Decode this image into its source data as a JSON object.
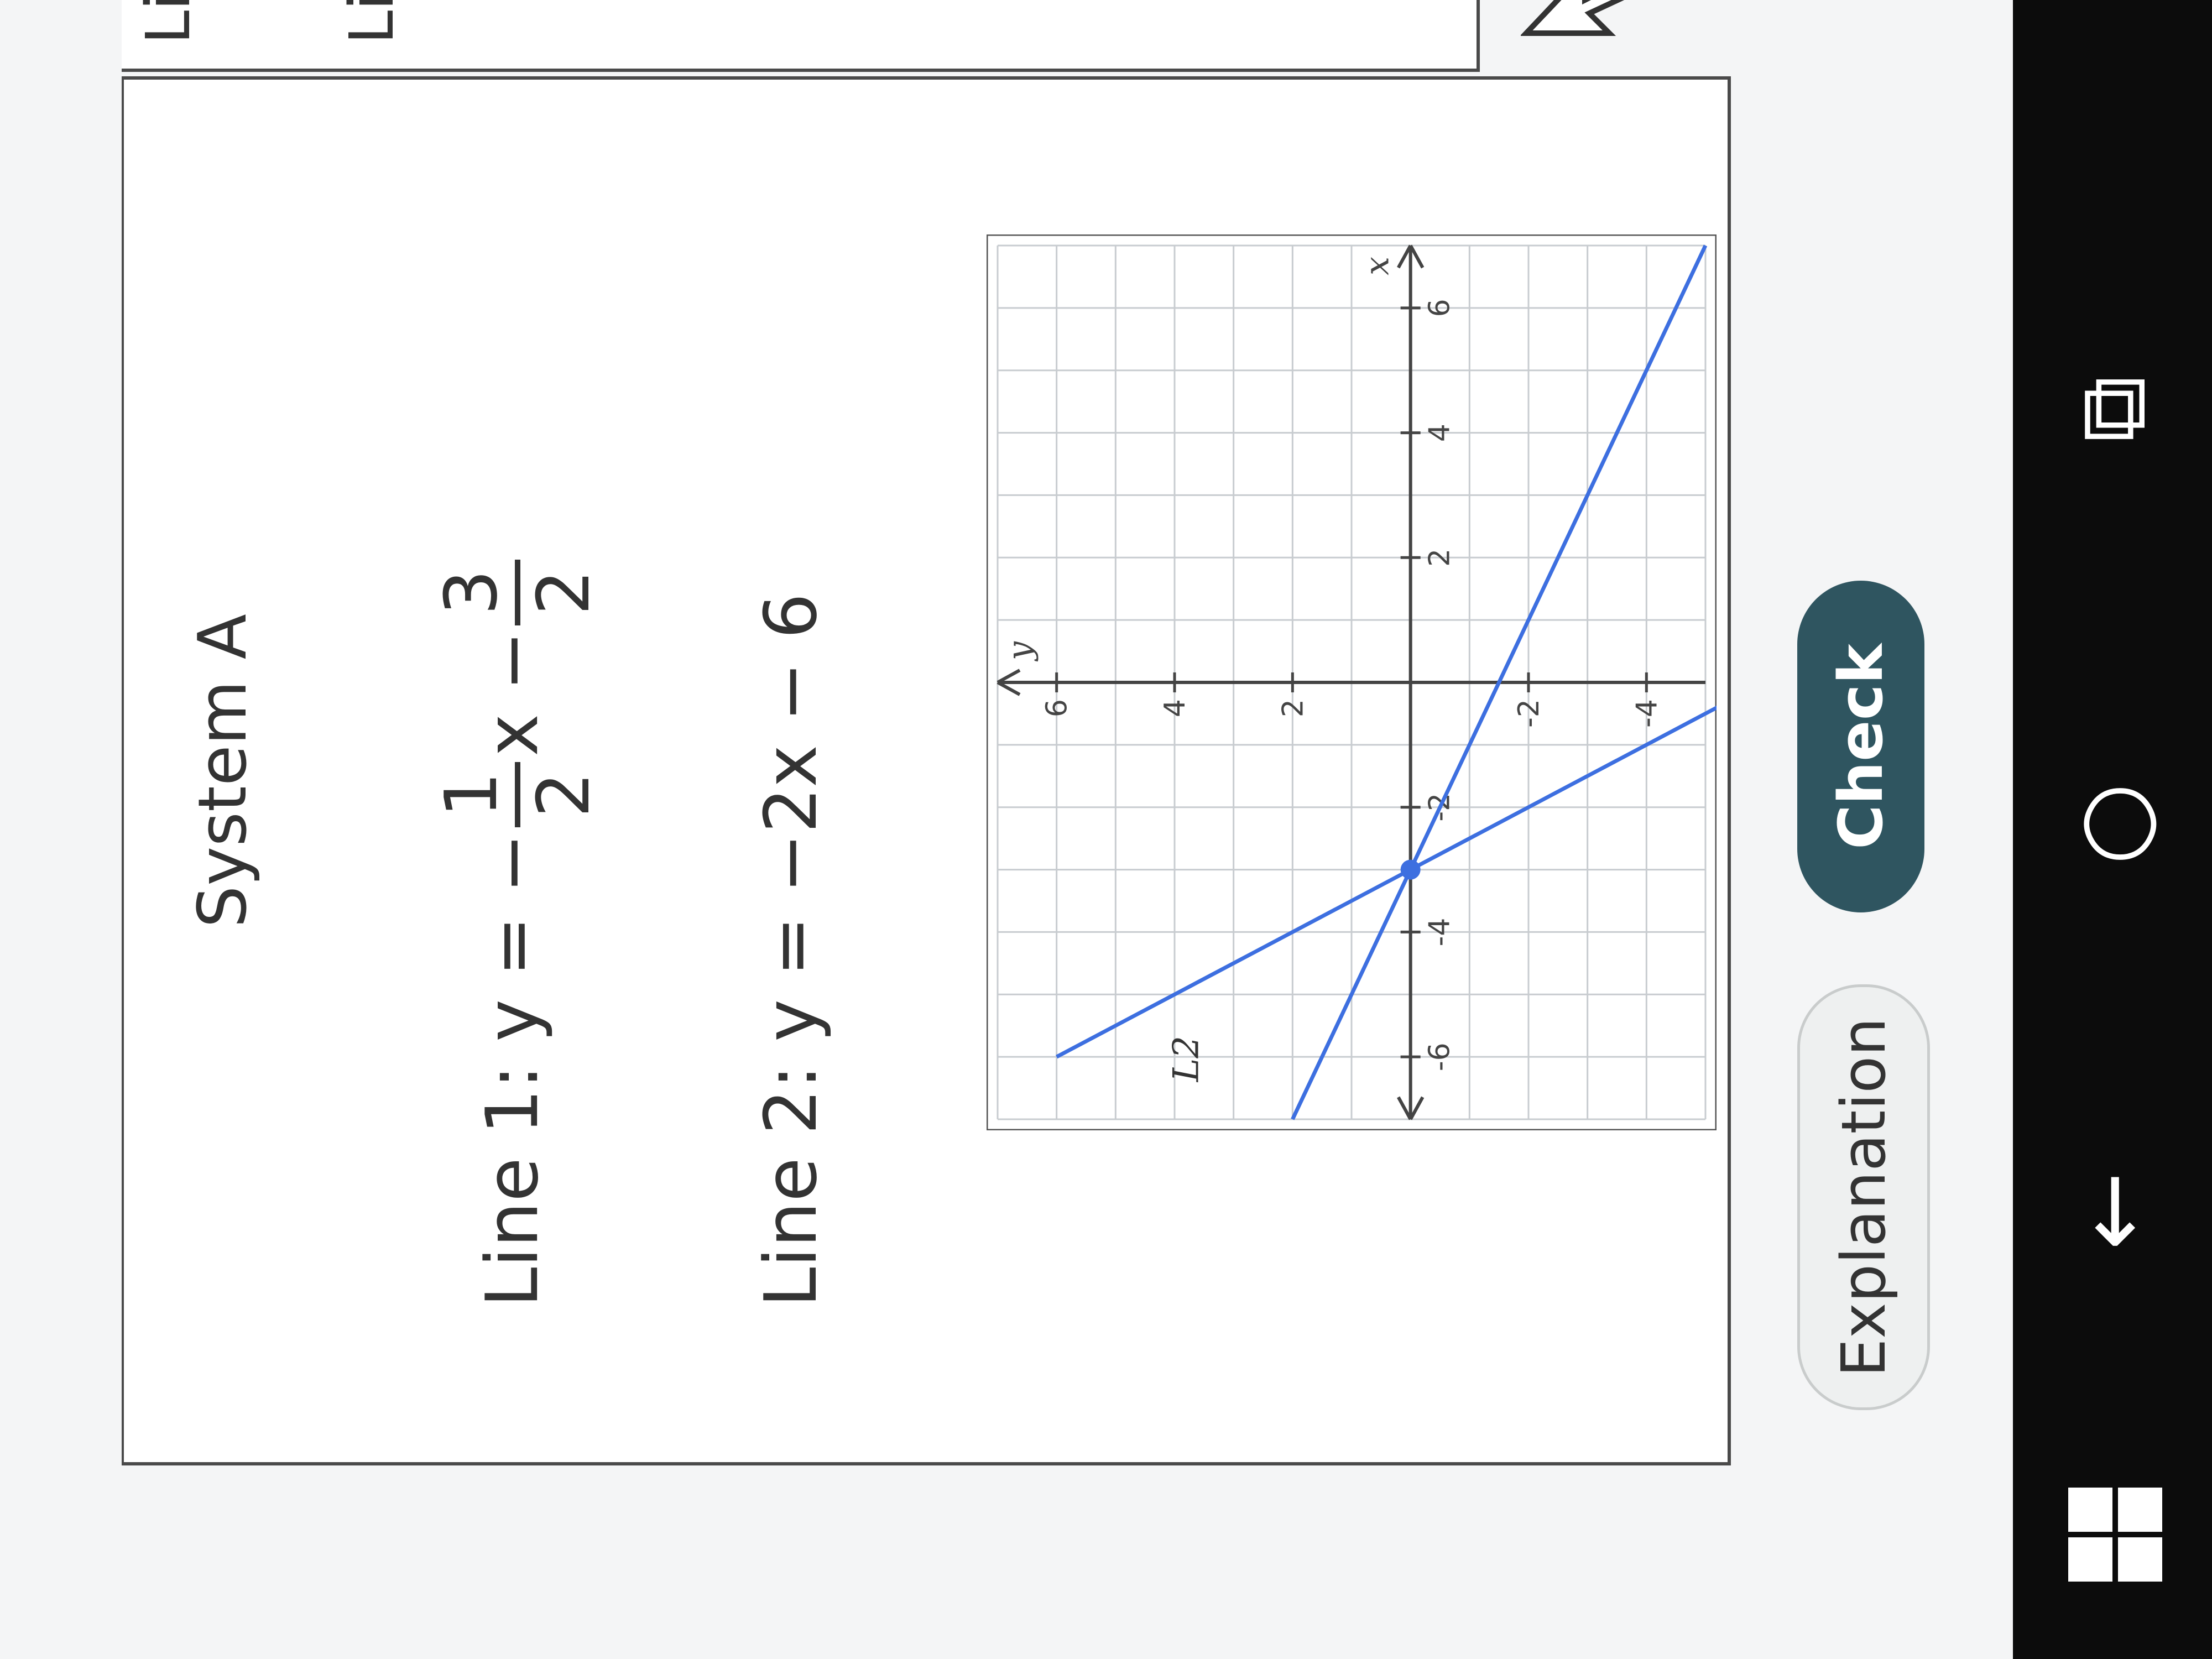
{
  "panel": {
    "title": "System A",
    "line1": {
      "prefix": "Line 1: y = −",
      "frac1_num": "1",
      "frac1_den": "2",
      "mid": "x −",
      "frac2_num": "3",
      "frac2_den": "2"
    },
    "line2": {
      "text": "Line 2: y = −2x − 6"
    }
  },
  "right_panel": {
    "items": [
      "Lin",
      "Lin"
    ]
  },
  "graph": {
    "x_label": "x",
    "y_label": "y",
    "line_label": "L2",
    "x_ticks": [
      "-6",
      "-4",
      "-2",
      "2",
      "4",
      "6"
    ],
    "y_ticks": [
      "6",
      "4",
      "2",
      "-2",
      "-4"
    ]
  },
  "buttons": {
    "explanation": "Explanation",
    "check": "Check"
  },
  "taskbar": {
    "back_glyph": "←",
    "home_glyph": "○",
    "multitask_glyph": "⧉"
  },
  "colors": {
    "line": "#3d6fe0",
    "check_bg": "#2f5560",
    "grid": "#c8ccd0"
  },
  "chart_data": {
    "type": "line",
    "x_range": [
      -7,
      7
    ],
    "y_range": [
      -5,
      7
    ],
    "grid": true,
    "series": [
      {
        "values": [
          [
            -7,
            2
          ],
          [
            7,
            -5
          ]
        ]
      },
      {
        "values": [
          [
            -6,
            6
          ],
          [
            0,
            -6
          ]
        ]
      }
    ],
    "intersection": [
      -3,
      0
    ]
  }
}
